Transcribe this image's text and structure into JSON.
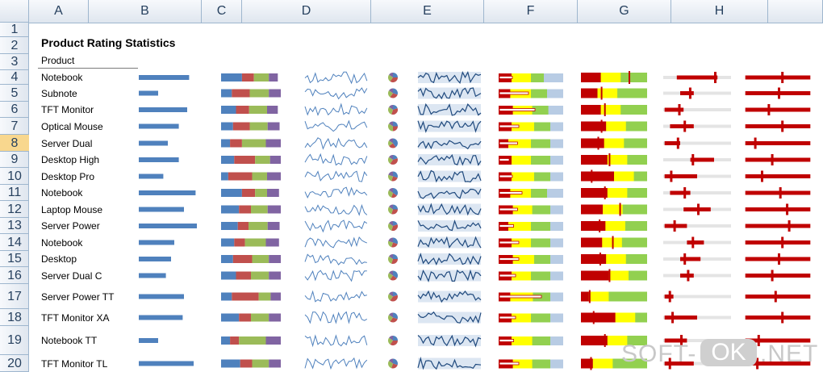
{
  "columns": [
    "A",
    "B",
    "C",
    "D",
    "E",
    "F",
    "G",
    "H",
    ""
  ],
  "rows": [
    "1",
    "2",
    "3",
    "4",
    "5",
    "6",
    "7",
    "8",
    "9",
    "10",
    "11",
    "12",
    "13",
    "14",
    "15",
    "16",
    "17",
    "18",
    "19",
    "20"
  ],
  "selected_row": "8",
  "title": "Product Rating Statistics",
  "product_header": "Product",
  "products": [
    "Notebook",
    "Subnote",
    "TFT Monitor",
    "Optical Mouse",
    "Server Dual",
    "Desktop High",
    "Desktop Pro",
    "Notebook",
    "Laptop Mouse",
    "Server Power",
    "Notebook",
    "Desktop",
    "Server Dual C",
    "Server Power TT",
    "TFT Monitor XA",
    "Notebook TT",
    "TFT Monitor TL"
  ],
  "colors": {
    "bar_blue": "#4f81bd",
    "stack": [
      "#4f81bd",
      "#c0504d",
      "#9bbb59",
      "#8064a2"
    ],
    "spark": "#4f81bd",
    "spark_dark": "#1f497d",
    "spark_band": "#dce6f2",
    "bullet_red": "#c00000",
    "bullet_yellow": "#ffff00",
    "bullet_green": "#92d050",
    "bullet_lightblue": "#b8cce4",
    "bar_red": "#c00000",
    "track_gray": "#e4e4e4"
  },
  "watermark": {
    "left": "SOFT-",
    "pill": "OK",
    "right": ".NET"
  },
  "sparkline_data": {
    "bars": [
      0.78,
      0.3,
      0.75,
      0.62,
      0.45,
      0.62,
      0.38,
      0.88,
      0.7,
      0.9,
      0.55,
      0.5,
      0.42,
      0.7,
      0.68,
      0.3,
      0.85
    ],
    "stacks": [
      [
        0.35,
        0.2,
        0.25,
        0.15
      ],
      [
        0.18,
        0.3,
        0.32,
        0.2
      ],
      [
        0.25,
        0.22,
        0.3,
        0.18
      ],
      [
        0.2,
        0.28,
        0.3,
        0.2
      ],
      [
        0.15,
        0.2,
        0.4,
        0.25
      ],
      [
        0.22,
        0.35,
        0.25,
        0.18
      ],
      [
        0.12,
        0.4,
        0.25,
        0.23
      ],
      [
        0.35,
        0.22,
        0.2,
        0.2
      ],
      [
        0.3,
        0.2,
        0.28,
        0.22
      ],
      [
        0.28,
        0.18,
        0.32,
        0.2
      ],
      [
        0.22,
        0.18,
        0.35,
        0.22
      ],
      [
        0.2,
        0.32,
        0.28,
        0.2
      ],
      [
        0.25,
        0.25,
        0.3,
        0.2
      ],
      [
        0.18,
        0.45,
        0.2,
        0.17
      ],
      [
        0.3,
        0.2,
        0.3,
        0.2
      ],
      [
        0.15,
        0.15,
        0.45,
        0.25
      ],
      [
        0.32,
        0.2,
        0.28,
        0.2
      ]
    ],
    "pies": [
      [
        0.25,
        0.35,
        0.25,
        0.15
      ],
      [
        0.3,
        0.3,
        0.25,
        0.15
      ],
      [
        0.2,
        0.35,
        0.3,
        0.15
      ],
      [
        0.25,
        0.25,
        0.35,
        0.15
      ],
      [
        0.4,
        0.25,
        0.2,
        0.15
      ],
      [
        0.2,
        0.4,
        0.25,
        0.15
      ],
      [
        0.3,
        0.25,
        0.25,
        0.2
      ],
      [
        0.35,
        0.2,
        0.3,
        0.15
      ],
      [
        0.25,
        0.3,
        0.3,
        0.15
      ],
      [
        0.2,
        0.35,
        0.3,
        0.15
      ],
      [
        0.3,
        0.25,
        0.25,
        0.2
      ],
      [
        0.25,
        0.3,
        0.3,
        0.15
      ],
      [
        0.35,
        0.25,
        0.25,
        0.15
      ],
      [
        0.2,
        0.4,
        0.25,
        0.15
      ],
      [
        0.3,
        0.3,
        0.25,
        0.15
      ],
      [
        0.25,
        0.35,
        0.25,
        0.15
      ],
      [
        0.3,
        0.25,
        0.3,
        0.15
      ]
    ],
    "bullets": [
      {
        "r": 0.2,
        "y": 0.3,
        "g": 0.2,
        "v": 0.2,
        "t": 0.25
      },
      {
        "r": 0.18,
        "y": 0.32,
        "g": 0.25,
        "v": 0.45,
        "t": 0.5
      },
      {
        "r": 0.22,
        "y": 0.3,
        "g": 0.25,
        "v": 0.55,
        "t": 0.35
      },
      {
        "r": 0.2,
        "y": 0.35,
        "g": 0.25,
        "v": 0.3,
        "t": 0.4
      },
      {
        "r": 0.15,
        "y": 0.35,
        "g": 0.3,
        "v": 0.28,
        "t": 0.3
      },
      {
        "r": 0.2,
        "y": 0.3,
        "g": 0.3,
        "v": 0.15,
        "t": 0.2
      },
      {
        "r": 0.2,
        "y": 0.35,
        "g": 0.25,
        "v": 0.2,
        "t": 0.18
      },
      {
        "r": 0.18,
        "y": 0.32,
        "g": 0.25,
        "v": 0.35,
        "t": 0.4
      },
      {
        "r": 0.22,
        "y": 0.3,
        "g": 0.28,
        "v": 0.28,
        "t": 0.32
      },
      {
        "r": 0.15,
        "y": 0.35,
        "g": 0.3,
        "v": 0.22,
        "t": 0.28
      },
      {
        "r": 0.2,
        "y": 0.3,
        "g": 0.3,
        "v": 0.3,
        "t": 0.35
      },
      {
        "r": 0.22,
        "y": 0.33,
        "g": 0.25,
        "v": 0.3,
        "t": 0.2
      },
      {
        "r": 0.2,
        "y": 0.3,
        "g": 0.3,
        "v": 0.25,
        "t": 0.3
      },
      {
        "r": 0.18,
        "y": 0.35,
        "g": 0.27,
        "v": 0.65,
        "t": 0.7
      },
      {
        "r": 0.2,
        "y": 0.3,
        "g": 0.3,
        "v": 0.25,
        "t": 0.3
      },
      {
        "r": 0.2,
        "y": 0.32,
        "g": 0.28,
        "v": 0.22,
        "t": 0.25
      },
      {
        "r": 0.22,
        "y": 0.3,
        "g": 0.28,
        "v": 0.3,
        "t": 0.35
      }
    ],
    "gauges": [
      {
        "r": 0.3,
        "v": 0.72
      },
      {
        "r": 0.25,
        "v": 0.3
      },
      {
        "r": 0.3,
        "v": 0.35
      },
      {
        "r": 0.38,
        "v": 0.3
      },
      {
        "r": 0.35,
        "v": 0.25
      },
      {
        "r": 0.4,
        "v": 0.42
      },
      {
        "r": 0.5,
        "v": 0.15
      },
      {
        "r": 0.4,
        "v": 0.35
      },
      {
        "r": 0.33,
        "v": 0.58
      },
      {
        "r": 0.37,
        "v": 0.27
      },
      {
        "r": 0.32,
        "v": 0.47
      },
      {
        "r": 0.38,
        "v": 0.28
      },
      {
        "r": 0.42,
        "v": 0.42
      },
      {
        "r": 0.12,
        "v": 0.12
      },
      {
        "r": 0.52,
        "v": 0.18
      },
      {
        "r": 0.4,
        "v": 0.35
      },
      {
        "r": 0.18,
        "v": 0.14
      }
    ],
    "ranges": [
      {
        "s": 0.2,
        "e": 0.8,
        "m": 0.75
      },
      {
        "s": 0.25,
        "e": 0.45,
        "m": 0.38
      },
      {
        "s": 0.02,
        "e": 0.3,
        "m": 0.22
      },
      {
        "s": 0.1,
        "e": 0.45,
        "m": 0.3
      },
      {
        "s": 0.02,
        "e": 0.25,
        "m": 0.2
      },
      {
        "s": 0.4,
        "e": 0.75,
        "m": 0.42
      },
      {
        "s": 0.02,
        "e": 0.5,
        "m": 0.1
      },
      {
        "s": 0.1,
        "e": 0.4,
        "m": 0.3
      },
      {
        "s": 0.3,
        "e": 0.7,
        "m": 0.5
      },
      {
        "s": 0.02,
        "e": 0.35,
        "m": 0.15
      },
      {
        "s": 0.35,
        "e": 0.6,
        "m": 0.42
      },
      {
        "s": 0.25,
        "e": 0.55,
        "m": 0.3
      },
      {
        "s": 0.25,
        "e": 0.45,
        "m": 0.35
      },
      {
        "s": 0.02,
        "e": 0.15,
        "m": 0.08
      },
      {
        "s": 0.02,
        "e": 0.5,
        "m": 0.12
      },
      {
        "s": 0.02,
        "e": 0.35,
        "m": 0.25
      },
      {
        "s": 0.02,
        "e": 0.45,
        "m": 0.08
      }
    ],
    "ranges2": [
      {
        "s": 0.02,
        "e": 0.98,
        "m": 0.55
      },
      {
        "s": 0.02,
        "e": 0.98,
        "m": 0.5
      },
      {
        "s": 0.02,
        "e": 0.98,
        "m": 0.35
      },
      {
        "s": 0.02,
        "e": 0.98,
        "m": 0.55
      },
      {
        "s": 0.02,
        "e": 0.98,
        "m": 0.15
      },
      {
        "s": 0.02,
        "e": 0.98,
        "m": 0.4
      },
      {
        "s": 0.02,
        "e": 0.98,
        "m": 0.25
      },
      {
        "s": 0.02,
        "e": 0.98,
        "m": 0.52
      },
      {
        "s": 0.02,
        "e": 0.98,
        "m": 0.62
      },
      {
        "s": 0.02,
        "e": 0.98,
        "m": 0.65
      },
      {
        "s": 0.02,
        "e": 0.98,
        "m": 0.55
      },
      {
        "s": 0.02,
        "e": 0.98,
        "m": 0.5
      },
      {
        "s": 0.02,
        "e": 0.98,
        "m": 0.4
      },
      {
        "s": 0.02,
        "e": 0.98,
        "m": 0.45
      },
      {
        "s": 0.02,
        "e": 0.98,
        "m": 0.55
      },
      {
        "s": 0.02,
        "e": 0.98,
        "m": 0.2
      },
      {
        "s": 0.02,
        "e": 0.98,
        "m": 0.18
      }
    ]
  }
}
